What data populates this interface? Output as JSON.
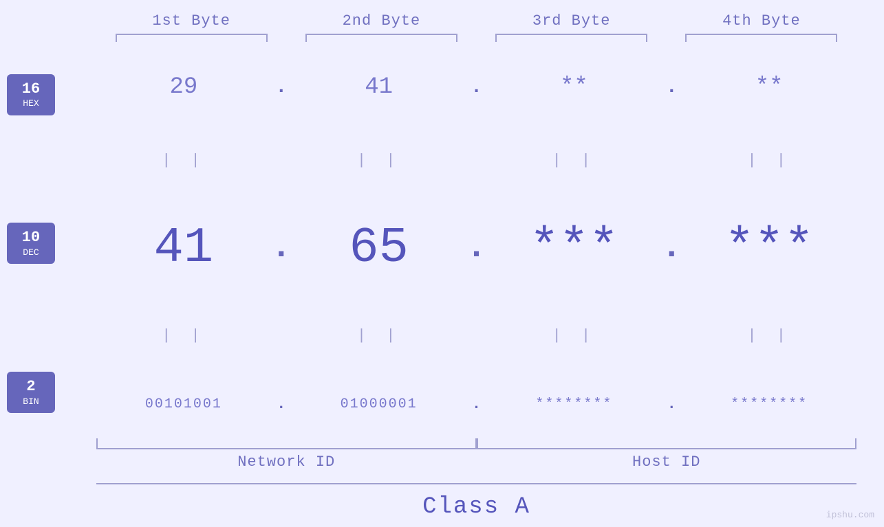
{
  "header": {
    "byte1": "1st Byte",
    "byte2": "2nd Byte",
    "byte3": "3rd Byte",
    "byte4": "4th Byte"
  },
  "bases": [
    {
      "num": "16",
      "name": "HEX"
    },
    {
      "num": "10",
      "name": "DEC"
    },
    {
      "num": "2",
      "name": "BIN"
    }
  ],
  "rows": {
    "hex": {
      "b1": "29",
      "b2": "41",
      "b3": "**",
      "b4": "**"
    },
    "dec": {
      "b1": "41",
      "b2": "65",
      "b3": "***",
      "b4": "***"
    },
    "bin": {
      "b1": "00101001",
      "b2": "01000001",
      "b3": "********",
      "b4": "********"
    }
  },
  "bottomLabels": {
    "network": "Network ID",
    "host": "Host ID"
  },
  "classLabel": "Class A",
  "watermark": "ipshu.com",
  "equals": "||"
}
